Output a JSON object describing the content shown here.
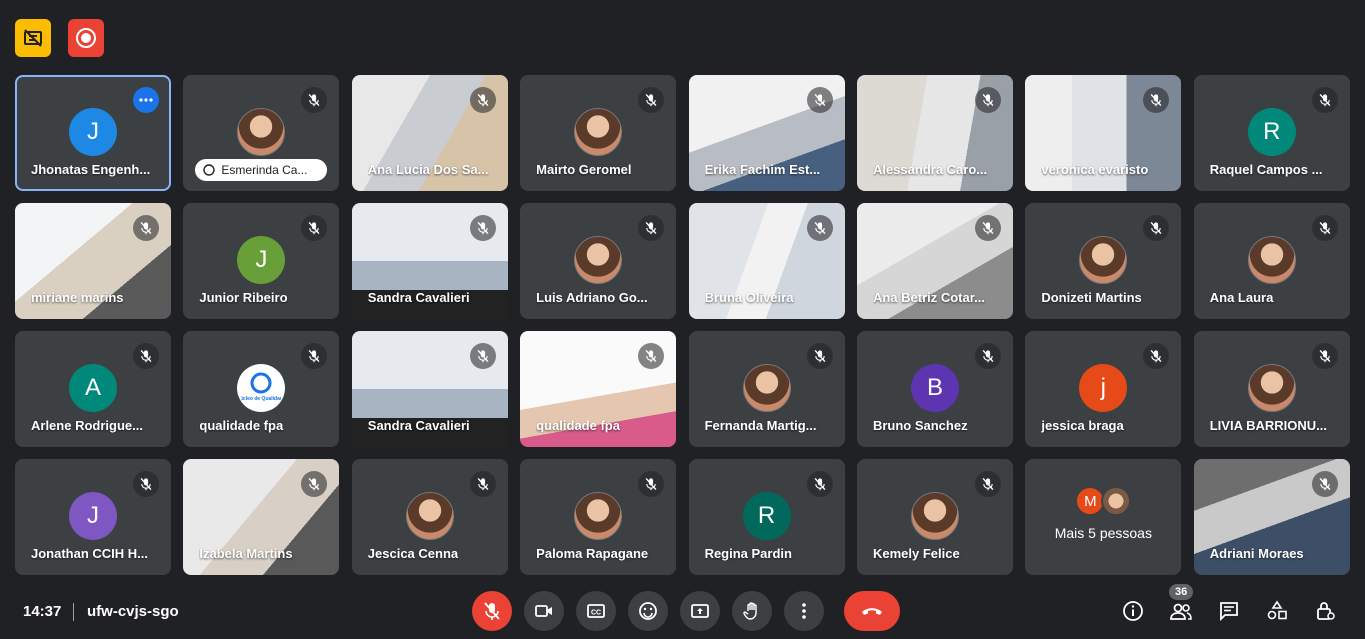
{
  "meeting": {
    "time": "14:37",
    "code": "ufw-cvjs-sgo",
    "participants_count": "36"
  },
  "top_icons": [
    {
      "name": "no-captions-icon",
      "color": "#fbbc04"
    },
    {
      "name": "recording-icon",
      "color": "#ea4335"
    }
  ],
  "participants": [
    {
      "name": "Jhonatas Engenh...",
      "type": "avatar",
      "initial": "J",
      "color": "#1e88e5",
      "active": true
    },
    {
      "name": "Esmerinda Ca...",
      "type": "photo-chip"
    },
    {
      "name": "Ana Lucia Dos Sa...",
      "type": "video",
      "video": "v1"
    },
    {
      "name": "Mairto Geromel",
      "type": "photo"
    },
    {
      "name": "Erika Fachim Est...",
      "type": "video",
      "video": "v2"
    },
    {
      "name": "Alessandra Caro...",
      "type": "video",
      "video": "v3"
    },
    {
      "name": "veronica evaristo",
      "type": "video",
      "video": "v4"
    },
    {
      "name": "Raquel Campos ...",
      "type": "avatar",
      "initial": "R",
      "color": "#00897b"
    },
    {
      "name": "miriane marins",
      "type": "video",
      "video": "v5"
    },
    {
      "name": "Junior Ribeiro",
      "type": "avatar",
      "initial": "J",
      "color": "#689f38"
    },
    {
      "name": "Sandra Cavalieri",
      "type": "video",
      "video": "v6"
    },
    {
      "name": "Luis Adriano Go...",
      "type": "photo"
    },
    {
      "name": "Bruna Oliveira",
      "type": "video",
      "video": "v7"
    },
    {
      "name": "Ana Betriz Cotar...",
      "type": "video",
      "video": "v8"
    },
    {
      "name": "Donizeti Martins",
      "type": "photo"
    },
    {
      "name": "Ana Laura",
      "type": "photo"
    },
    {
      "name": "Arlene Rodrigue...",
      "type": "avatar",
      "initial": "A",
      "color": "#00897b"
    },
    {
      "name": "qualidade fpa",
      "type": "logo",
      "initial": "Núcleo de Qualidade"
    },
    {
      "name": "Sandra Cavalieri",
      "type": "video",
      "video": "v6"
    },
    {
      "name": "qualidade fpa",
      "type": "video",
      "video": "v10"
    },
    {
      "name": "Fernanda Martig...",
      "type": "photo"
    },
    {
      "name": "Bruno Sanchez",
      "type": "avatar",
      "initial": "B",
      "color": "#5e35b1"
    },
    {
      "name": "jessica braga",
      "type": "avatar",
      "initial": "j",
      "color": "#e64a19"
    },
    {
      "name": "LIVIA BARRIONU...",
      "type": "photo"
    },
    {
      "name": "Jonathan CCIH H...",
      "type": "avatar",
      "initial": "J",
      "color": "#7e57c2"
    },
    {
      "name": "Izabela Martins",
      "type": "video",
      "video": "v11"
    },
    {
      "name": "Jescica Cenna",
      "type": "photo"
    },
    {
      "name": "Paloma Rapagane",
      "type": "photo"
    },
    {
      "name": "Regina Pardin",
      "type": "avatar",
      "initial": "R",
      "color": "#00695c"
    },
    {
      "name": "Kemely Felice",
      "type": "photo"
    },
    {
      "name": "Mais 5 pessoas",
      "type": "more",
      "initial": "M",
      "color": "#e64a19"
    },
    {
      "name": "Adriani Moraes",
      "type": "video",
      "video": "v12"
    }
  ],
  "controls": [
    "mic-off-icon",
    "camera-icon",
    "captions-icon",
    "emoji-icon",
    "present-icon",
    "raise-hand-icon",
    "more-options-icon",
    "end-call-icon"
  ],
  "right_controls": [
    "info-icon",
    "people-icon",
    "chat-icon",
    "activities-icon",
    "host-controls-icon"
  ]
}
